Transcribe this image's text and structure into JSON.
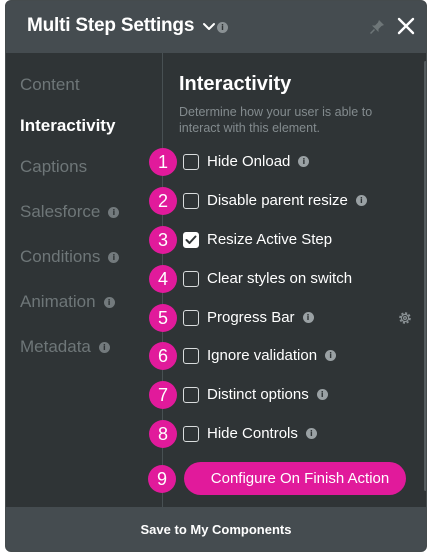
{
  "header": {
    "title": "Multi Step Settings"
  },
  "sidebar": {
    "items": [
      {
        "label": "Content",
        "info": false,
        "active": false
      },
      {
        "label": "Interactivity",
        "info": false,
        "active": true
      },
      {
        "label": "Captions",
        "info": false,
        "active": false
      },
      {
        "label": "Salesforce",
        "info": true,
        "active": false
      },
      {
        "label": "Conditions",
        "info": true,
        "active": false
      },
      {
        "label": "Animation",
        "info": true,
        "active": false
      },
      {
        "label": "Metadata",
        "info": true,
        "active": false
      }
    ]
  },
  "section": {
    "title": "Interactivity",
    "description": "Determine how your user is able to interact with this element."
  },
  "options": [
    {
      "num": "1",
      "label": "Hide Onload",
      "checked": false,
      "info": true
    },
    {
      "num": "2",
      "label": "Disable parent resize",
      "checked": false,
      "info": true
    },
    {
      "num": "3",
      "label": "Resize Active Step",
      "checked": true,
      "info": false
    },
    {
      "num": "4",
      "label": "Clear styles on switch",
      "checked": false,
      "info": false
    },
    {
      "num": "5",
      "label": "Progress Bar",
      "checked": false,
      "info": true,
      "gear": true
    },
    {
      "num": "6",
      "label": "Ignore validation",
      "checked": false,
      "info": true
    },
    {
      "num": "7",
      "label": "Distinct options",
      "checked": false,
      "info": true
    },
    {
      "num": "8",
      "label": "Hide Controls",
      "checked": false,
      "info": true
    }
  ],
  "action": {
    "num": "9",
    "label": "Configure On Finish Action"
  },
  "footer": {
    "label": "Save to My Components"
  },
  "icons": {
    "info_glyph": "i"
  },
  "colors": {
    "accent": "#e11a9b",
    "panel_bg": "#2f3436",
    "header_bg": "#454c50"
  }
}
